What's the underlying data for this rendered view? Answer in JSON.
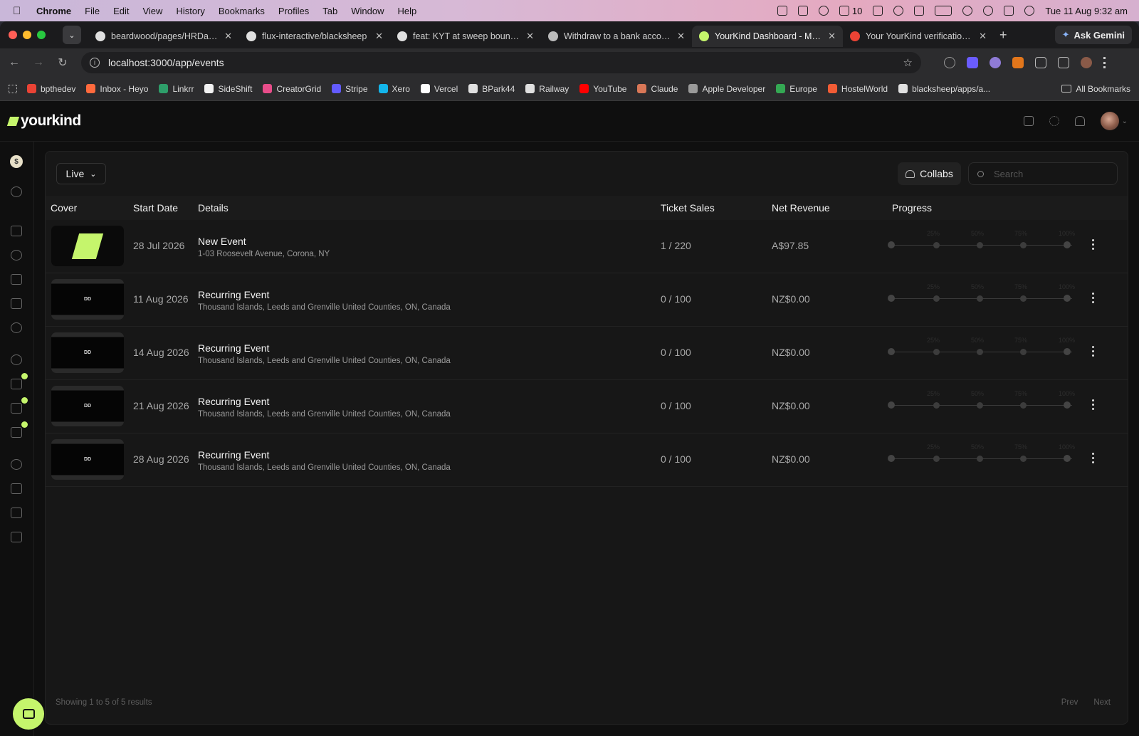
{
  "menubar": {
    "app": "Chrome",
    "items": [
      "File",
      "Edit",
      "View",
      "History",
      "Bookmarks",
      "Profiles",
      "Tab",
      "Window",
      "Help"
    ],
    "battery_count": "10",
    "datetime": "Tue 11 Aug  9:32 am"
  },
  "tabs": [
    {
      "title": "beardwood/pages/HRDashb",
      "icon": "github-icon",
      "fav": "#e0e0e0"
    },
    {
      "title": "flux-interactive/blacksheep",
      "icon": "github-icon",
      "fav": "#e0e0e0"
    },
    {
      "title": "feat: KYT at sweep boundary",
      "icon": "github-icon",
      "fav": "#e0e0e0"
    },
    {
      "title": "Withdraw to a bank account",
      "icon": "heart-icon",
      "fav": "#bbbbbb"
    },
    {
      "title": "YourKind Dashboard - Mana",
      "icon": "yourkind-icon",
      "fav": "#c5f56c",
      "active": true
    },
    {
      "title": "Your YourKind verification co",
      "icon": "gmail-icon",
      "fav": "#ea4335"
    }
  ],
  "ask_gemini": "Ask Gemini",
  "url": "localhost:3000/app/events",
  "bookmarks": [
    {
      "label": "bpthedev",
      "color": "#ea4335"
    },
    {
      "label": "Inbox - Heyo",
      "color": "#ff6a3d"
    },
    {
      "label": "Linkrr",
      "color": "#2e9e6a"
    },
    {
      "label": "SideShift",
      "color": "#f2f2f2"
    },
    {
      "label": "CreatorGrid",
      "color": "#e84d8a"
    },
    {
      "label": "Stripe",
      "color": "#635bff"
    },
    {
      "label": "Xero",
      "color": "#13b5ea"
    },
    {
      "label": "Vercel",
      "color": "#ffffff"
    },
    {
      "label": "BPark44",
      "color": "#e0e0e0"
    },
    {
      "label": "Railway",
      "color": "#e0e0e0"
    },
    {
      "label": "YouTube",
      "color": "#ff0000"
    },
    {
      "label": "Claude",
      "color": "#d97757"
    },
    {
      "label": "Apple Developer",
      "color": "#9a9a9a"
    },
    {
      "label": "Europe",
      "color": "#34a853"
    },
    {
      "label": "HostelWorld",
      "color": "#f25c35"
    },
    {
      "label": "blacksheep/apps/a...",
      "color": "#e0e0e0"
    }
  ],
  "all_bookmarks": "All Bookmarks",
  "app": {
    "logo": "yourkind",
    "brand_color": "#c5f56c"
  },
  "filter": {
    "selected": "Live"
  },
  "collabs_label": "Collabs",
  "search_placeholder": "Search",
  "columns": [
    "Cover",
    "Start Date",
    "Details",
    "Ticket Sales",
    "Net Revenue",
    "Progress"
  ],
  "progress_labels": [
    "25%",
    "50%",
    "75%",
    "100%"
  ],
  "events": [
    {
      "cover": "yourkind-logo",
      "start_date": "28 Jul 2026",
      "name": "New Event",
      "address": "1-03 Roosevelt Avenue, Corona, NY",
      "ticket_sales": "1 / 220",
      "net_revenue": "A$97.85",
      "progress": 0.0045
    },
    {
      "cover": "DD",
      "start_date": "11 Aug 2026",
      "name": "Recurring Event",
      "address": "Thousand Islands, Leeds and Grenville United Counties, ON, Canada",
      "ticket_sales": "0 / 100",
      "net_revenue": "NZ$0.00",
      "progress": 0
    },
    {
      "cover": "DD",
      "start_date": "14 Aug 2026",
      "name": "Recurring Event",
      "address": "Thousand Islands, Leeds and Grenville United Counties, ON, Canada",
      "ticket_sales": "0 / 100",
      "net_revenue": "NZ$0.00",
      "progress": 0
    },
    {
      "cover": "DD",
      "start_date": "21 Aug 2026",
      "name": "Recurring Event",
      "address": "Thousand Islands, Leeds and Grenville United Counties, ON, Canada",
      "ticket_sales": "0 / 100",
      "net_revenue": "NZ$0.00",
      "progress": 0
    },
    {
      "cover": "DD",
      "start_date": "28 Aug 2026",
      "name": "Recurring Event",
      "address": "Thousand Islands, Leeds and Grenville United Counties, ON, Canada",
      "ticket_sales": "0 / 100",
      "net_revenue": "NZ$0.00",
      "progress": 0
    }
  ],
  "footer": {
    "summary": "Showing 1 to 5 of 5 results",
    "prev": "Prev",
    "next": "Next"
  }
}
